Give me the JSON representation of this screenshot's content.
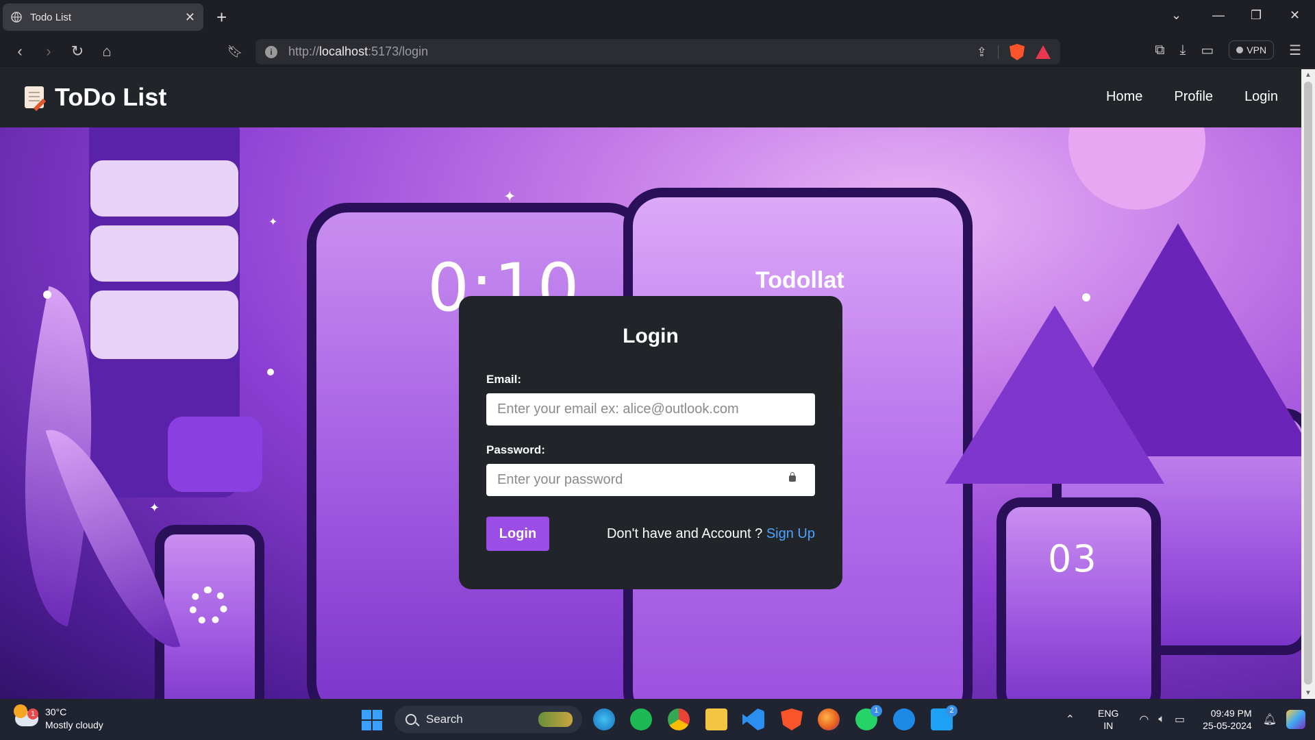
{
  "browser": {
    "tab_title": "Todo List",
    "url_scheme": "http://",
    "url_host": "localhost",
    "url_rest": ":5173/login",
    "vpn_label": "VPN"
  },
  "navbar": {
    "brand": "ToDo List",
    "links": [
      "Home",
      "Profile",
      "Login"
    ]
  },
  "hero_art": {
    "time_text": "0:10",
    "app_title": "Todollat",
    "small_number": "03"
  },
  "login": {
    "title": "Login",
    "email_label": "Email:",
    "email_placeholder": "Enter your email ex: alice@outlook.com",
    "password_label": "Password:",
    "password_placeholder": "Enter your password",
    "submit_label": "Login",
    "signup_prompt": "Don't have and Account ? ",
    "signup_link": "Sign Up"
  },
  "taskbar": {
    "weather_temp": "30°C",
    "weather_desc": "Mostly cloudy",
    "weather_badge": "1",
    "search_label": "Search",
    "whatsapp_badge": "1",
    "twitter_badge": "2",
    "lang_top": "ENG",
    "lang_bottom": "IN",
    "time": "09:49 PM",
    "date": "25-05-2024"
  },
  "colors": {
    "navbar_bg": "#212529",
    "card_bg": "#212529",
    "primary_button": "#9b4ee6",
    "link": "#4da3ff"
  }
}
